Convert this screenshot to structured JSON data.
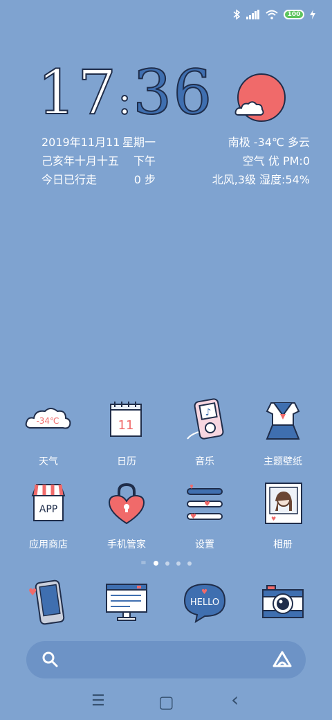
{
  "status_bar": {
    "battery": "100"
  },
  "clock": {
    "hour": "17",
    "separator": ":",
    "minute": "36"
  },
  "date_info": {
    "date": "2019年11月11",
    "weekday": "星期一",
    "lunar": "己亥年十月十五",
    "period": "下午",
    "steps_label": "今日已行走",
    "steps_value": "0 步"
  },
  "weather": {
    "location_temp_desc": "南极  -34℃  多云",
    "air_quality": "空气  优  PM:0",
    "wind_humidity": "北风,3级  湿度:54%",
    "icon": "sun-cloud-icon"
  },
  "apps_row1": [
    {
      "label": "天气",
      "icon": "weather-cloud-icon",
      "badge": "-34℃"
    },
    {
      "label": "日历",
      "icon": "calendar-icon",
      "badge": "11"
    },
    {
      "label": "音乐",
      "icon": "music-player-icon"
    },
    {
      "label": "主题壁纸",
      "icon": "sailor-uniform-icon"
    }
  ],
  "apps_row2": [
    {
      "label": "应用商店",
      "icon": "app-store-icon",
      "badge": "APP"
    },
    {
      "label": "手机管家",
      "icon": "heart-lock-icon"
    },
    {
      "label": "设置",
      "icon": "settings-sliders-icon"
    },
    {
      "label": "相册",
      "icon": "photo-album-icon"
    }
  ],
  "dock": [
    {
      "icon": "phone-icon"
    },
    {
      "icon": "browser-icon"
    },
    {
      "icon": "message-hello-icon",
      "text": "HELLO"
    },
    {
      "icon": "camera-icon"
    }
  ],
  "pages": {
    "count": 4,
    "active": 1
  },
  "nav": {
    "menu": "☰",
    "home": "▢",
    "back": "‹"
  },
  "colors": {
    "background": "#7fa3d0",
    "accent_red": "#f06a6a",
    "outline": "#1f2d4a"
  }
}
